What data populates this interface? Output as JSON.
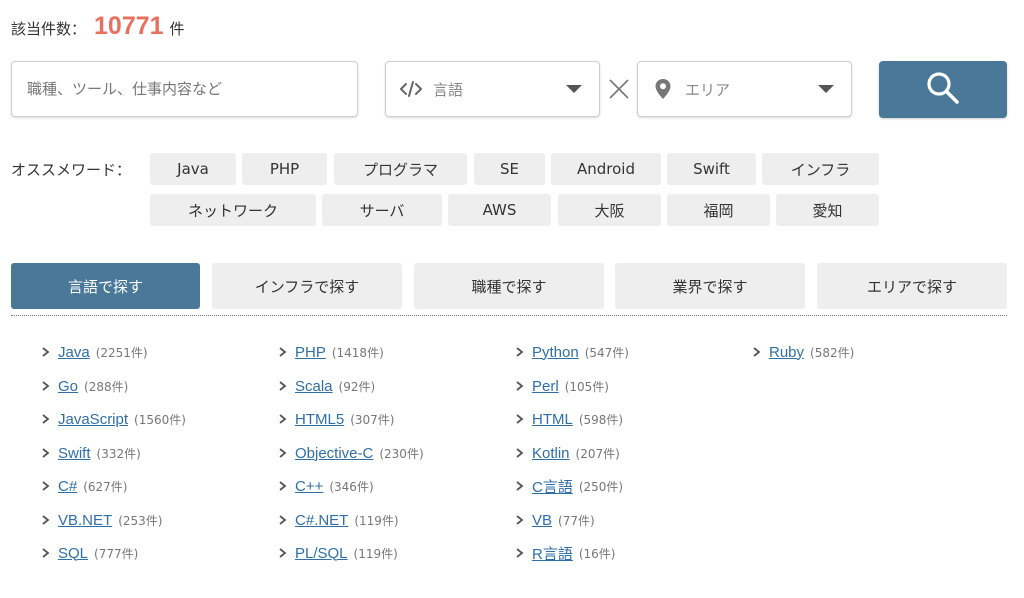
{
  "count": {
    "label": "該当件数：",
    "value": "10771",
    "unit": "件",
    "color": "#e8705f"
  },
  "search": {
    "keyword_placeholder": "職種、ツール、仕事内容など",
    "language_label": "言語",
    "area_label": "エリア",
    "language_icon": "code-icon",
    "area_icon": "location-pin-icon",
    "button_icon": "search-icon",
    "accent": "#4a7899"
  },
  "recommended": {
    "label": "オススメワード：",
    "tags": [
      "Java",
      "PHP",
      "プログラマ",
      "SE",
      "Android",
      "Swift",
      "インフラ",
      "ネットワーク",
      "サーバ",
      "AWS",
      "大阪",
      "福岡",
      "愛知"
    ]
  },
  "tabs": [
    {
      "label": "言語で探す",
      "active": true
    },
    {
      "label": "インフラで探す",
      "active": false
    },
    {
      "label": "職種で探す",
      "active": false
    },
    {
      "label": "業界で探す",
      "active": false
    },
    {
      "label": "エリアで探す",
      "active": false
    }
  ],
  "languages": [
    {
      "name": "Java",
      "count": "(2251件)"
    },
    {
      "name": "Go",
      "count": "(288件)"
    },
    {
      "name": "JavaScript",
      "count": "(1560件)"
    },
    {
      "name": "Swift",
      "count": "(332件)"
    },
    {
      "name": "C#",
      "count": "(627件)"
    },
    {
      "name": "VB.NET",
      "count": "(253件)"
    },
    {
      "name": "SQL",
      "count": "(777件)"
    },
    {
      "name": "PHP",
      "count": "(1418件)"
    },
    {
      "name": "Scala",
      "count": "(92件)"
    },
    {
      "name": "HTML5",
      "count": "(307件)"
    },
    {
      "name": "Objective-C",
      "count": "(230件)"
    },
    {
      "name": "C++",
      "count": "(346件)"
    },
    {
      "name": "C#.NET",
      "count": "(119件)"
    },
    {
      "name": "PL/SQL",
      "count": "(119件)"
    },
    {
      "name": "Python",
      "count": "(547件)"
    },
    {
      "name": "Perl",
      "count": "(105件)"
    },
    {
      "name": "HTML",
      "count": "(598件)"
    },
    {
      "name": "Kotlin",
      "count": "(207件)"
    },
    {
      "name": "C言語",
      "count": "(250件)"
    },
    {
      "name": "VB",
      "count": "(77件)"
    },
    {
      "name": "R言語",
      "count": "(16件)"
    },
    {
      "name": "Ruby",
      "count": "(582件)"
    }
  ]
}
